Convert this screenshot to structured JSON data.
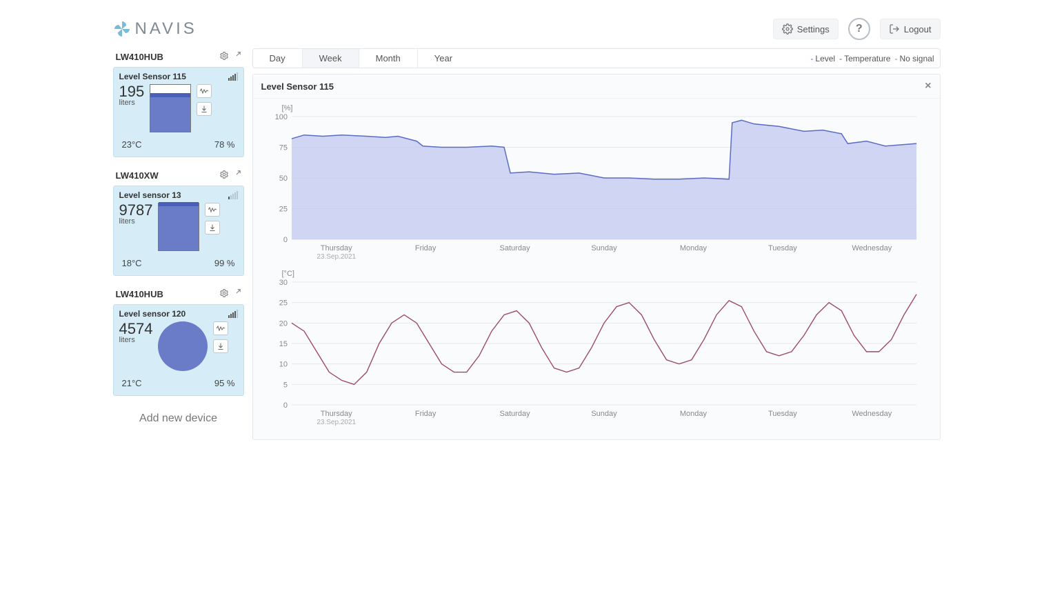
{
  "brand": {
    "name": "NAVIS"
  },
  "header": {
    "settings_label": "Settings",
    "help_label": "?",
    "logout_label": "Logout"
  },
  "sidebar": {
    "groups": [
      {
        "name": "LW410HUB",
        "card": {
          "title": "Level Sensor 115",
          "value": "195",
          "unit": "liters",
          "level_pct": 78,
          "temp": "23°C",
          "pct_label": "78 %",
          "signal": 4,
          "tank_shape": "rect"
        }
      },
      {
        "name": "LW410XW",
        "card": {
          "title": "Level sensor 13",
          "value": "9787",
          "unit": "liters",
          "level_pct": 99,
          "temp": "18°C",
          "pct_label": "99 %",
          "signal": 1,
          "tank_shape": "rect"
        }
      },
      {
        "name": "LW410HUB",
        "card": {
          "title": "Level sensor 120",
          "value": "4574",
          "unit": "liters",
          "level_pct": 95,
          "temp": "21°C",
          "pct_label": "95 %",
          "signal": 4,
          "tank_shape": "circle"
        }
      }
    ],
    "add_label": "Add new device"
  },
  "timerange": {
    "tabs": [
      "Day",
      "Week",
      "Month",
      "Year"
    ],
    "active": "Week"
  },
  "legend": {
    "level": "Level",
    "temperature": "Temperature",
    "nosignal": "No signal"
  },
  "panel": {
    "title": "Level Sensor 115"
  },
  "chart_data": [
    {
      "type": "area",
      "title": "Level Sensor 115",
      "ylabel": "[%]",
      "ylim": [
        0,
        100
      ],
      "yticks": [
        0,
        25,
        50,
        75,
        100
      ],
      "categories": [
        "Thursday",
        "Friday",
        "Saturday",
        "Sunday",
        "Monday",
        "Tuesday",
        "Wednesday"
      ],
      "xsubs": [
        "23.Sep.2021",
        "",
        "",
        "",
        "",
        "",
        ""
      ],
      "points": [
        [
          0,
          82
        ],
        [
          2,
          85
        ],
        [
          5,
          84
        ],
        [
          8,
          85
        ],
        [
          12,
          84
        ],
        [
          15,
          83
        ],
        [
          17,
          84
        ],
        [
          20,
          80
        ],
        [
          21,
          76
        ],
        [
          24,
          75
        ],
        [
          28,
          75
        ],
        [
          32,
          76
        ],
        [
          34,
          75
        ],
        [
          35,
          54
        ],
        [
          38,
          55
        ],
        [
          42,
          53
        ],
        [
          46,
          54
        ],
        [
          50,
          50
        ],
        [
          54,
          50
        ],
        [
          58,
          49
        ],
        [
          62,
          49
        ],
        [
          66,
          50
        ],
        [
          70,
          49
        ],
        [
          70.5,
          95
        ],
        [
          72,
          97
        ],
        [
          74,
          94
        ],
        [
          78,
          92
        ],
        [
          82,
          88
        ],
        [
          85,
          89
        ],
        [
          88,
          86
        ],
        [
          89,
          78
        ],
        [
          92,
          80
        ],
        [
          95,
          76
        ],
        [
          100,
          78
        ]
      ]
    },
    {
      "type": "line",
      "ylabel": "[°C]",
      "ylim": [
        0,
        30
      ],
      "yticks": [
        0,
        5,
        10,
        15,
        20,
        25,
        30
      ],
      "categories": [
        "Thursday",
        "Friday",
        "Saturday",
        "Sunday",
        "Monday",
        "Tuesday",
        "Wednesday"
      ],
      "xsubs": [
        "23.Sep.2021",
        "",
        "",
        "",
        "",
        "",
        ""
      ],
      "points": [
        [
          0,
          20
        ],
        [
          2,
          18
        ],
        [
          4,
          13
        ],
        [
          6,
          8
        ],
        [
          8,
          6
        ],
        [
          10,
          5
        ],
        [
          12,
          8
        ],
        [
          14,
          15
        ],
        [
          16,
          20
        ],
        [
          18,
          22
        ],
        [
          20,
          20
        ],
        [
          22,
          15
        ],
        [
          24,
          10
        ],
        [
          26,
          8
        ],
        [
          28,
          8
        ],
        [
          30,
          12
        ],
        [
          32,
          18
        ],
        [
          34,
          22
        ],
        [
          36,
          23
        ],
        [
          38,
          20
        ],
        [
          40,
          14
        ],
        [
          42,
          9
        ],
        [
          44,
          8
        ],
        [
          46,
          9
        ],
        [
          48,
          14
        ],
        [
          50,
          20
        ],
        [
          52,
          24
        ],
        [
          54,
          25
        ],
        [
          56,
          22
        ],
        [
          58,
          16
        ],
        [
          60,
          11
        ],
        [
          62,
          10
        ],
        [
          64,
          11
        ],
        [
          66,
          16
        ],
        [
          68,
          22
        ],
        [
          70,
          25.5
        ],
        [
          72,
          24
        ],
        [
          74,
          18
        ],
        [
          76,
          13
        ],
        [
          78,
          12
        ],
        [
          80,
          13
        ],
        [
          82,
          17
        ],
        [
          84,
          22
        ],
        [
          86,
          25
        ],
        [
          88,
          23
        ],
        [
          90,
          17
        ],
        [
          92,
          13
        ],
        [
          94,
          13
        ],
        [
          96,
          16
        ],
        [
          98,
          22
        ],
        [
          100,
          27
        ]
      ]
    }
  ]
}
